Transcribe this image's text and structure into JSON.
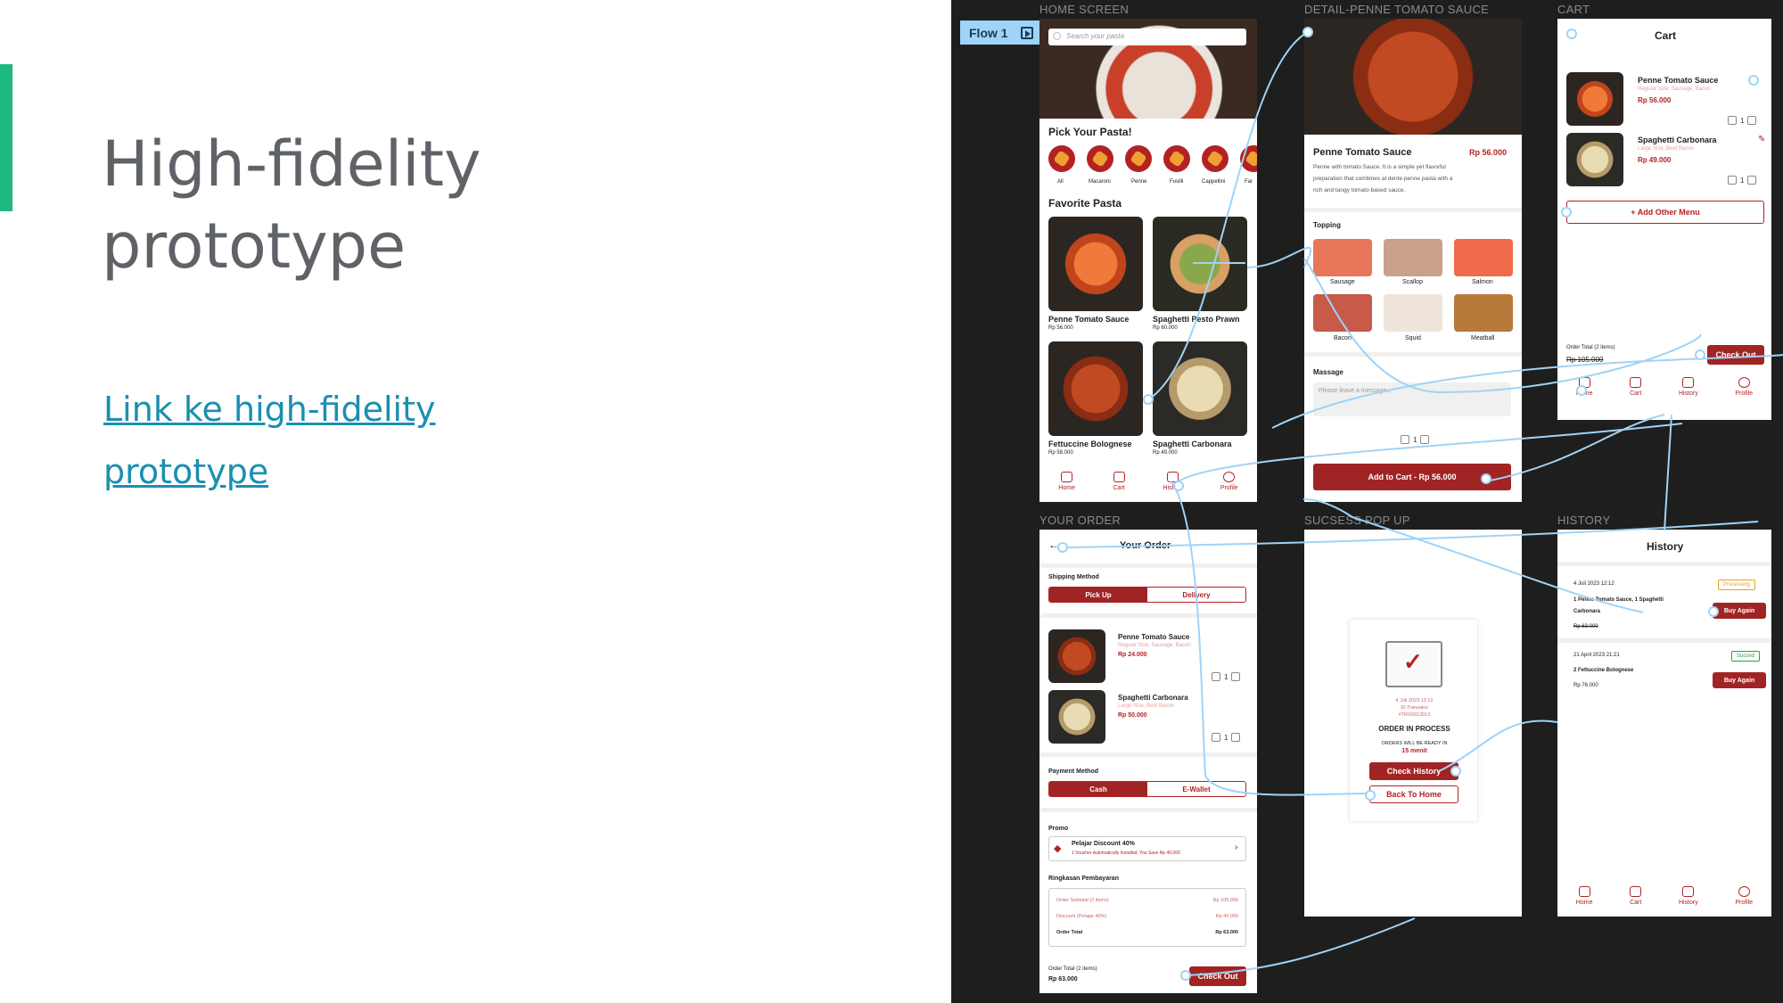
{
  "colors": {
    "accent_bar": "#1db97d",
    "link": "#1a8fb0",
    "brand_red": "#a12424",
    "canvas_bg": "#1e1e1e",
    "wire": "#9fd3f7"
  },
  "slide": {
    "title_line1": "High-fidelity",
    "title_line2": "prototype",
    "link_line1": "Link ke high-fidelity",
    "link_line2": "prototype"
  },
  "canvas": {
    "flow_label": "Flow 1",
    "frame_labels": {
      "home": "HOME SCREEN",
      "detail": "DETAIL-PENNE TOMATO SAUCE",
      "cart": "CART",
      "order": "YOUR ORDER",
      "popup": "SUCSESS POP UP",
      "history": "HISTORY"
    }
  },
  "home": {
    "search_placeholder": "Search your pasta",
    "pick_title": "Pick Your Pasta!",
    "categories": [
      "All",
      "Macaroni",
      "Penne",
      "Fusilli",
      "Cappellini",
      "Far"
    ],
    "favorite_title": "Favorite Pasta",
    "items": [
      {
        "name": "Penne Tomato Sauce",
        "price": "Rp 56.000",
        "icon": "penne-dish"
      },
      {
        "name": "Spaghetti Pesto Prawn",
        "price": "Rp 60.000",
        "icon": "pesto-dish"
      },
      {
        "name": "Fettuccine Bolognese",
        "price": "Rp 58.000",
        "icon": "bolognese-dish"
      },
      {
        "name": "Spaghetti Carbonara",
        "price": "Rp 49.000",
        "icon": "carbonara-dish"
      }
    ]
  },
  "nav": {
    "home": "Home",
    "cart": "Cart",
    "history": "History",
    "profile": "Profile"
  },
  "detail": {
    "name": "Penne Tomato Sauce",
    "price": "Rp 56.000",
    "desc1": "Penne with tomato Sauce. It is a simple yet flavorful",
    "desc2": "preparation that combines al dente penne pasta with a",
    "desc3": "rich and tangy tomato-based sauce.",
    "topping_title": "Topping",
    "toppings": [
      "Sausage",
      "Scallop",
      "Salmon",
      "Bacon",
      "Squid",
      "Meatball"
    ],
    "message_title": "Massage",
    "message_placeholder": "Please leave a message...",
    "qty": "1",
    "add_button": "Add to Cart - Rp 56.000"
  },
  "cart": {
    "title": "Cart",
    "items": [
      {
        "name": "Penne Tomato Sauce",
        "note": "Regular Size, Sausage, Bacon",
        "price": "Rp 56.000",
        "qty": "1"
      },
      {
        "name": "Spaghetti Carbonara",
        "note": "Large Size, Beef Bacon",
        "price": "Rp 49.000",
        "qty": "1"
      }
    ],
    "add_other": "+ Add Other Menu",
    "order_total_label": "Order Total (2 items)",
    "order_total": "Rp 105.000",
    "checkout": "Check Out"
  },
  "order": {
    "title": "Your Order",
    "shipping_title": "Shipping Method",
    "shipping_options": [
      "Pick Up",
      "Delivery"
    ],
    "items": [
      {
        "name": "Penne Tomato Sauce",
        "note": "Regular Size, Sausage, Bacon",
        "price": "Rp 24.000",
        "qty": "1"
      },
      {
        "name": "Spaghetti Carbonara",
        "note": "Large Size, Beef Bacon",
        "price": "Rp 50.000",
        "qty": "1"
      }
    ],
    "payment_title": "Payment Method",
    "payment_options": [
      "Cash",
      "E-Wallet"
    ],
    "promo_title": "Promo",
    "promo_name": "Pelajar Discount 40%",
    "promo_sub": "1 Voucher Automatically Installed, You Save Rp 40.000",
    "summary_title": "Ringkasan Pembayaran",
    "summary_rows": [
      {
        "label": "Order Subtotal (2 items)",
        "value": "Rp 105.000"
      },
      {
        "label": "Discount (Pelajar 40%)",
        "value": "Rp 40.000"
      },
      {
        "label": "Order Total",
        "value": "Rp 63.000"
      }
    ],
    "footer_label": "Order Total (2 items)",
    "footer_total": "Rp 63.000",
    "checkout": "Check Out"
  },
  "popup": {
    "date": "4 Juli 2023 12:12",
    "order_no": "ID Transaksi",
    "order_code": "#TRX0012013",
    "status": "ORDER IN PROCESS",
    "ready_line": "ORDERS WILL BE READY IN",
    "ready_time": "15 menit",
    "check_history": "Check History",
    "back_home": "Back To Home"
  },
  "history": {
    "title": "History",
    "orders": [
      {
        "date": "4 Juli 2023 12:12",
        "status": "Processing",
        "desc1": "1 Penne Tomato Sauce, 1 Spaghetti",
        "desc2": "Carbonara",
        "price": "Rp 63.000",
        "button": "Buy Again"
      },
      {
        "date": "21 April 2023 21:21",
        "status": "Succed",
        "desc1": "2 Fettuccine Bolognese",
        "desc2": "",
        "price": "Rp 76.000",
        "button": "Buy Again"
      }
    ]
  }
}
